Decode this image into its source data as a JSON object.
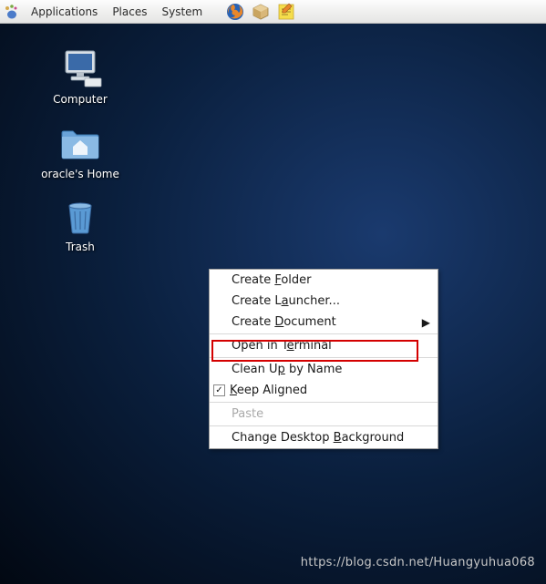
{
  "menubar": {
    "applications": "Applications",
    "places": "Places",
    "system": "System"
  },
  "desktop_icons": {
    "computer": "Computer",
    "home": "oracle's Home",
    "trash": "Trash"
  },
  "context_menu": {
    "create_folder_pre": "Create ",
    "create_folder_u": "F",
    "create_folder_post": "older",
    "create_launcher_pre": "Create L",
    "create_launcher_u": "a",
    "create_launcher_post": "uncher...",
    "create_document_pre": "Create ",
    "create_document_u": "D",
    "create_document_post": "ocument",
    "open_terminal_pre": "Open in T",
    "open_terminal_u": "e",
    "open_terminal_post": "rminal",
    "clean_up_pre": "Clean U",
    "clean_up_u": "p",
    "clean_up_post": " by Name",
    "keep_aligned_pre": "",
    "keep_aligned_u": "K",
    "keep_aligned_post": "eep Aligned",
    "paste": "Paste",
    "change_bg_pre": "Change Desktop ",
    "change_bg_u": "B",
    "change_bg_post": "ackground",
    "checkbox_mark": "✓"
  },
  "watermark": "https://blog.csdn.net/Huangyuhua068"
}
